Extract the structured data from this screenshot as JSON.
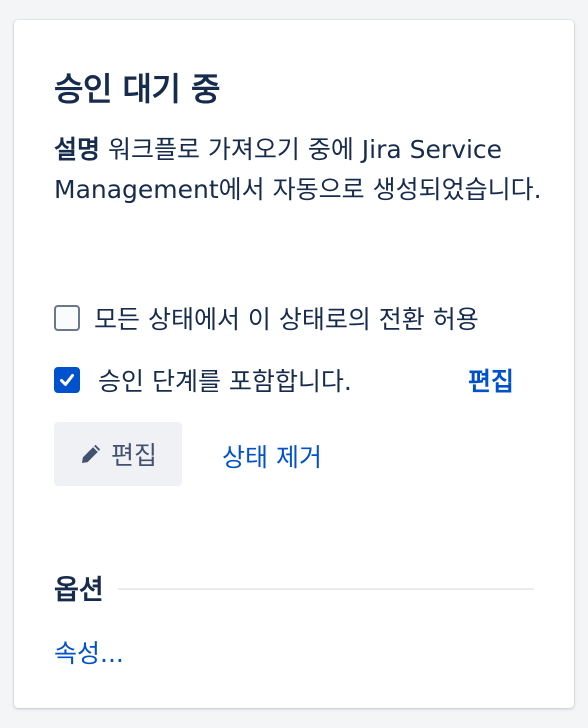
{
  "panel": {
    "title": "승인 대기 중",
    "description_label": "설명",
    "description_text": " 워크플로 가져오기 중에 Jira Service Management에서 자동으로 생성되었습니다.",
    "allow_all_label": "모든 상태에서 이 상태로의 전환 허용",
    "allow_all_checked": false,
    "include_approval_label": "승인 단계를 포함합니다.",
    "include_approval_checked": true,
    "include_approval_edit": "편집",
    "edit_button": "편집",
    "remove_status": "상태 제거",
    "options_title": "옵션",
    "properties_link": "속성..."
  },
  "colors": {
    "accent": "#0052cc",
    "text": "#172b4d",
    "button_bg": "#f0f1f4"
  },
  "icons": {
    "edit": "pencil-icon",
    "check": "checkmark-icon"
  }
}
